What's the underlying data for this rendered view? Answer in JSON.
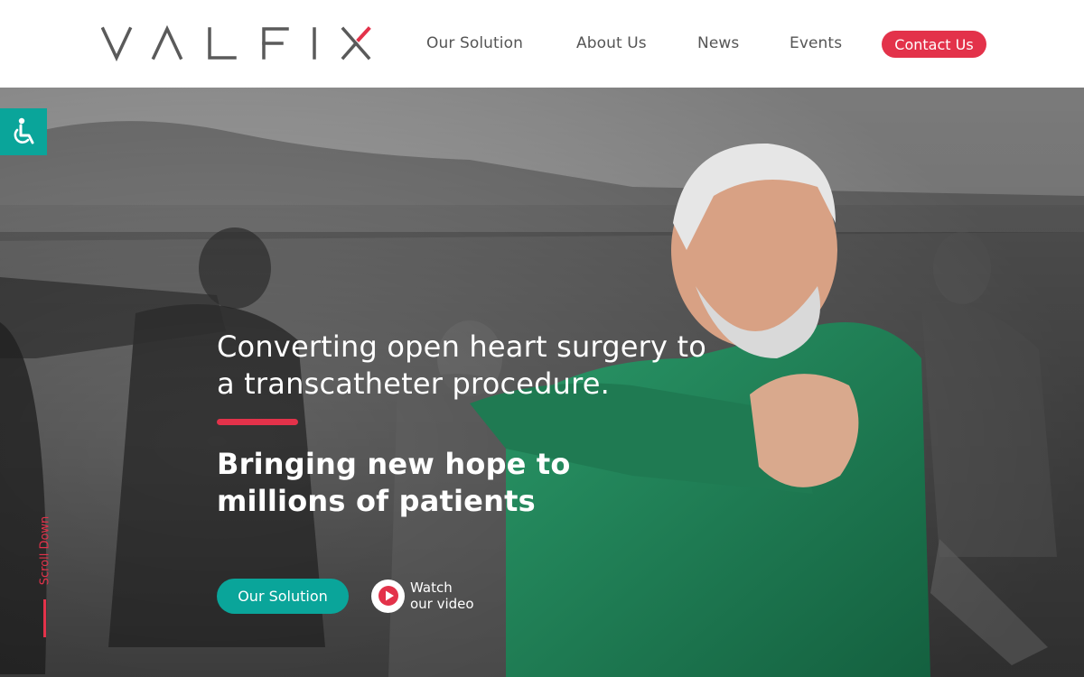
{
  "brand": {
    "logo_text": "VALFIX",
    "accent": "#e3324a",
    "teal": "#0aa59a"
  },
  "nav": {
    "items": [
      "Our Solution",
      "About Us",
      "News",
      "Events"
    ],
    "contact": "Contact Us"
  },
  "accessibility": {
    "icon": "wheelchair-icon"
  },
  "hero": {
    "headline": "Converting open heart surgery to a transcatheter procedure.",
    "subline": "Bringing new hope to millions of patients",
    "cta_label": "Our Solution",
    "video_label_1": "Watch",
    "video_label_2": "our video",
    "scroll_label": "Scroll Down"
  }
}
